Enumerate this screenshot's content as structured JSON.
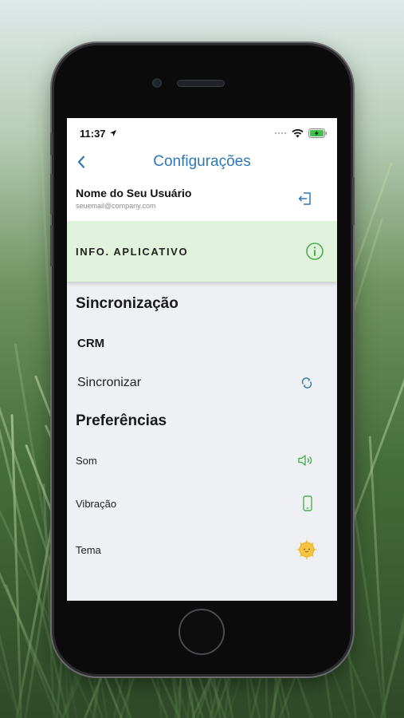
{
  "status_bar": {
    "time": "11:37",
    "icons": [
      "location-arrow-icon",
      "signal-icon",
      "wifi-icon",
      "battery-charging-icon"
    ]
  },
  "nav": {
    "title": "Configurações",
    "back_icon": "chevron-left-icon"
  },
  "user": {
    "name": "Nome do Seu Usuário",
    "email": "seuemail@company.com",
    "logout_icon": "logout-icon"
  },
  "info": {
    "label": "INFO. APLICATIVO",
    "icon": "info-circle-icon"
  },
  "sync_section": {
    "title": "Sincronização",
    "crm_label": "CRM",
    "sync_label": "Sincronizar",
    "sync_icon": "sync-arrows-icon"
  },
  "prefs_section": {
    "title": "Preferências",
    "items": [
      {
        "label": "Som",
        "icon": "speaker-icon"
      },
      {
        "label": "Vibração",
        "icon": "phone-vibrate-icon"
      },
      {
        "label": "Tema",
        "icon": "sun-theme-icon"
      }
    ]
  },
  "colors": {
    "accent_blue": "#2f77b5",
    "green": "#4caf50",
    "info_bg": "#e1f2dd",
    "screen_bg": "#eff0f3",
    "sun": "#f5c542"
  }
}
